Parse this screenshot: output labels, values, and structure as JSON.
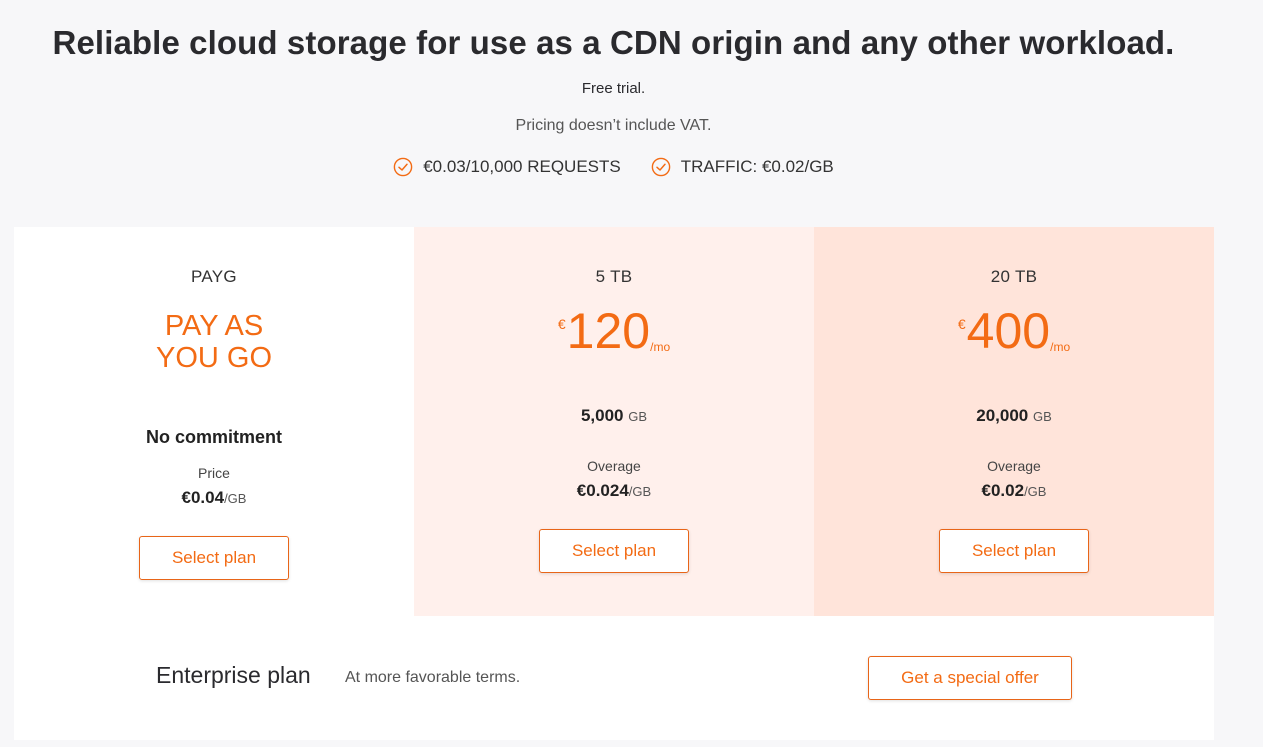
{
  "header": {
    "title": "Reliable cloud storage for use as a CDN origin and any other workload.",
    "free_trial": "Free trial.",
    "vat_note": "Pricing doesn’t include VAT."
  },
  "features": [
    {
      "icon": "check-circle-icon",
      "label": "€0.03/10,000 REQUESTS"
    },
    {
      "icon": "check-circle-icon",
      "label": "TRAFFIC: €0.02/GB"
    }
  ],
  "accent_color": "#f36b14",
  "plans": {
    "payg": {
      "name": "PAYG",
      "headline": "PAY AS YOU GO",
      "commitment": "No commitment",
      "price_label": "Price",
      "price_value": "€0.04",
      "price_unit": "/GB",
      "button": "Select plan"
    },
    "tb5": {
      "name": "5 TB",
      "currency": "€",
      "amount": "120",
      "period": "/mo",
      "volume": "5,000",
      "volume_unit": "GB",
      "overage_label": "Overage",
      "overage_value": "€0.024",
      "overage_unit": "/GB",
      "button": "Select plan"
    },
    "tb20": {
      "name": "20 TB",
      "currency": "€",
      "amount": "400",
      "period": "/mo",
      "volume": "20,000",
      "volume_unit": "GB",
      "overage_label": "Overage",
      "overage_value": "€0.02",
      "overage_unit": "/GB",
      "button": "Select plan"
    }
  },
  "enterprise": {
    "title": "Enterprise plan",
    "subtitle": "At more favorable terms.",
    "button": "Get a special offer"
  }
}
